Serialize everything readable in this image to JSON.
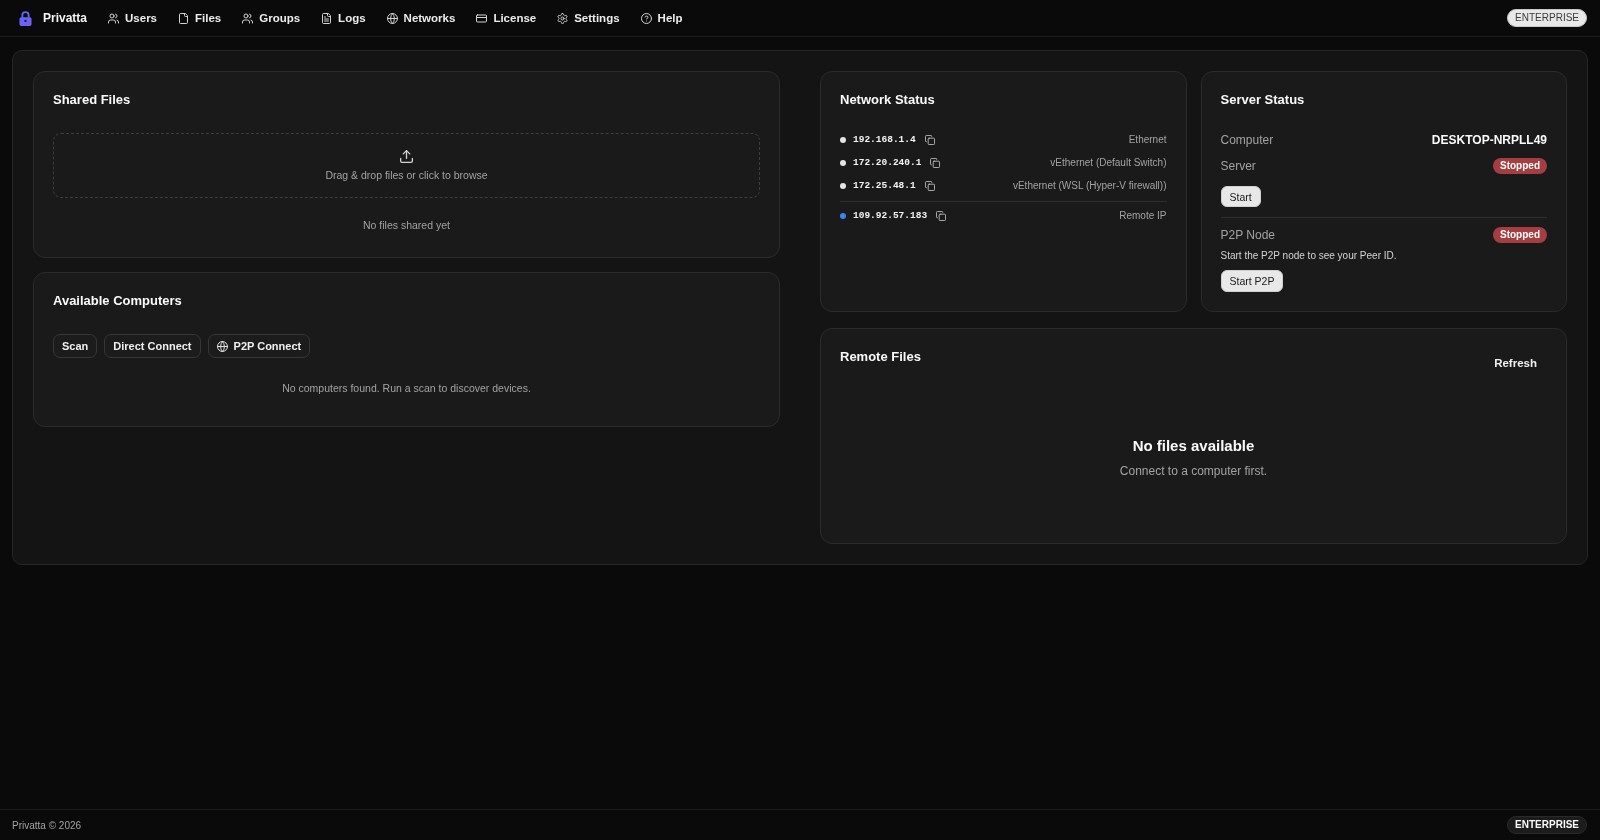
{
  "header": {
    "brand": "Privatta",
    "nav": [
      {
        "label": "Users",
        "selected": false
      },
      {
        "label": "Files",
        "selected": false
      },
      {
        "label": "Groups",
        "selected": false
      },
      {
        "label": "Logs",
        "selected": false
      },
      {
        "label": "Networks",
        "selected": false
      },
      {
        "label": "License",
        "selected": false
      },
      {
        "label": "Settings",
        "selected": false
      },
      {
        "label": "Help",
        "selected": false
      }
    ],
    "badge": "ENTERPRISE"
  },
  "shared_files": {
    "title": "Shared Files",
    "dropzone_text": "Drag & drop files or click to browse",
    "empty_text": "No files shared yet"
  },
  "available_computers": {
    "title": "Available Computers",
    "scan_button": "Scan",
    "direct_connect_button": "Direct Connect",
    "p2p_connect_button": "P2P Connect",
    "empty_text": "No computers found. Run a scan to discover devices."
  },
  "network_status": {
    "title": "Network Status",
    "local_addresses": [
      {
        "address": "192.168.1.4",
        "interface": "Ethernet",
        "color": "#e5e5e5"
      },
      {
        "address": "172.20.240.1",
        "interface": "vEthernet (Default Switch)",
        "color": "#e5e5e5"
      },
      {
        "address": "172.25.48.1",
        "interface": "vEthernet (WSL (Hyper-V firewall))",
        "color": "#e5e5e5"
      }
    ],
    "remote_address": {
      "address": "109.92.57.183",
      "label": "Remote IP",
      "color": "#3b82f6"
    }
  },
  "server_status": {
    "title": "Server Status",
    "computer": {
      "label": "Computer",
      "value": "DESKTOP-NRPLL49"
    },
    "server": {
      "label": "Server",
      "status": "Stopped",
      "running": false,
      "button": "Start"
    },
    "p2p_node": {
      "label": "P2P Node",
      "status": "Stopped",
      "running": false,
      "hint": "Start the P2P node to see your Peer ID.",
      "button": "Start P2P"
    }
  },
  "remote_files": {
    "title": "Remote Files",
    "refresh_button": "Refresh",
    "empty_title": "No files available",
    "empty_text": "Connect to a computer first."
  },
  "footer": {
    "copyright": "Privatta © 2026",
    "badge": "ENTERPRISE"
  }
}
